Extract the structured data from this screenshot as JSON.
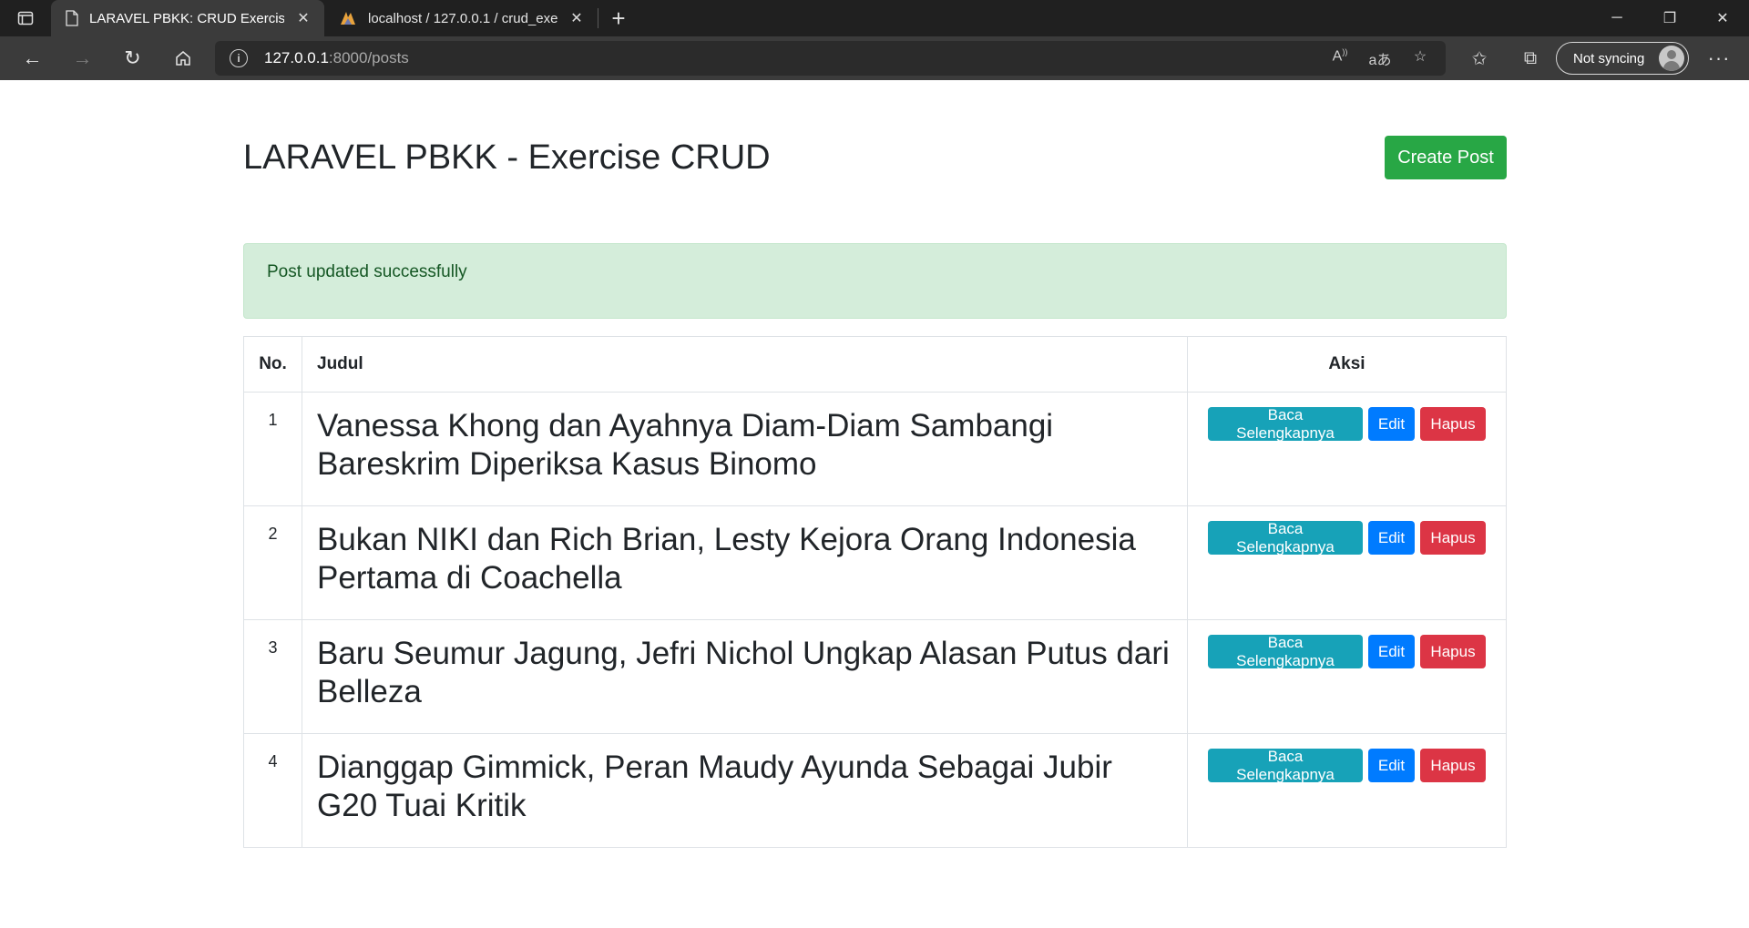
{
  "browser": {
    "tabs": [
      {
        "title": "LARAVEL PBKK: CRUD Exercise",
        "active": true
      },
      {
        "title": "localhost / 127.0.0.1 / crud_exercise",
        "active": false
      }
    ],
    "address": {
      "host": "127.0.0.1",
      "rest": ":8000/posts"
    },
    "sync_label": "Not syncing"
  },
  "page": {
    "title": "LARAVEL PBKK - Exercise CRUD",
    "create_button": "Create Post",
    "alert": "Post updated successfully",
    "table": {
      "headers": {
        "no": "No.",
        "judul": "Judul",
        "aksi": "Aksi"
      },
      "rows": [
        {
          "no": "1",
          "judul": "Vanessa Khong dan Ayahnya Diam-Diam Sambangi Bareskrim Diperiksa Kasus Binomo"
        },
        {
          "no": "2",
          "judul": "Bukan NIKI dan Rich Brian, Lesty Kejora Orang Indonesia Pertama di Coachella"
        },
        {
          "no": "3",
          "judul": "Baru Seumur Jagung, Jefri Nichol Ungkap Alasan Putus dari Belleza"
        },
        {
          "no": "4",
          "judul": "Dianggap Gimmick, Peran Maudy Ayunda Sebagai Jubir G20 Tuai Kritik"
        }
      ],
      "actions": {
        "read": "Baca Selengkapnya",
        "edit": "Edit",
        "delete": "Hapus"
      }
    }
  },
  "colors": {
    "success": "#28a745",
    "info": "#17a2b8",
    "primary": "#007bff",
    "danger": "#dc3545",
    "alert_bg": "#d4edda"
  }
}
